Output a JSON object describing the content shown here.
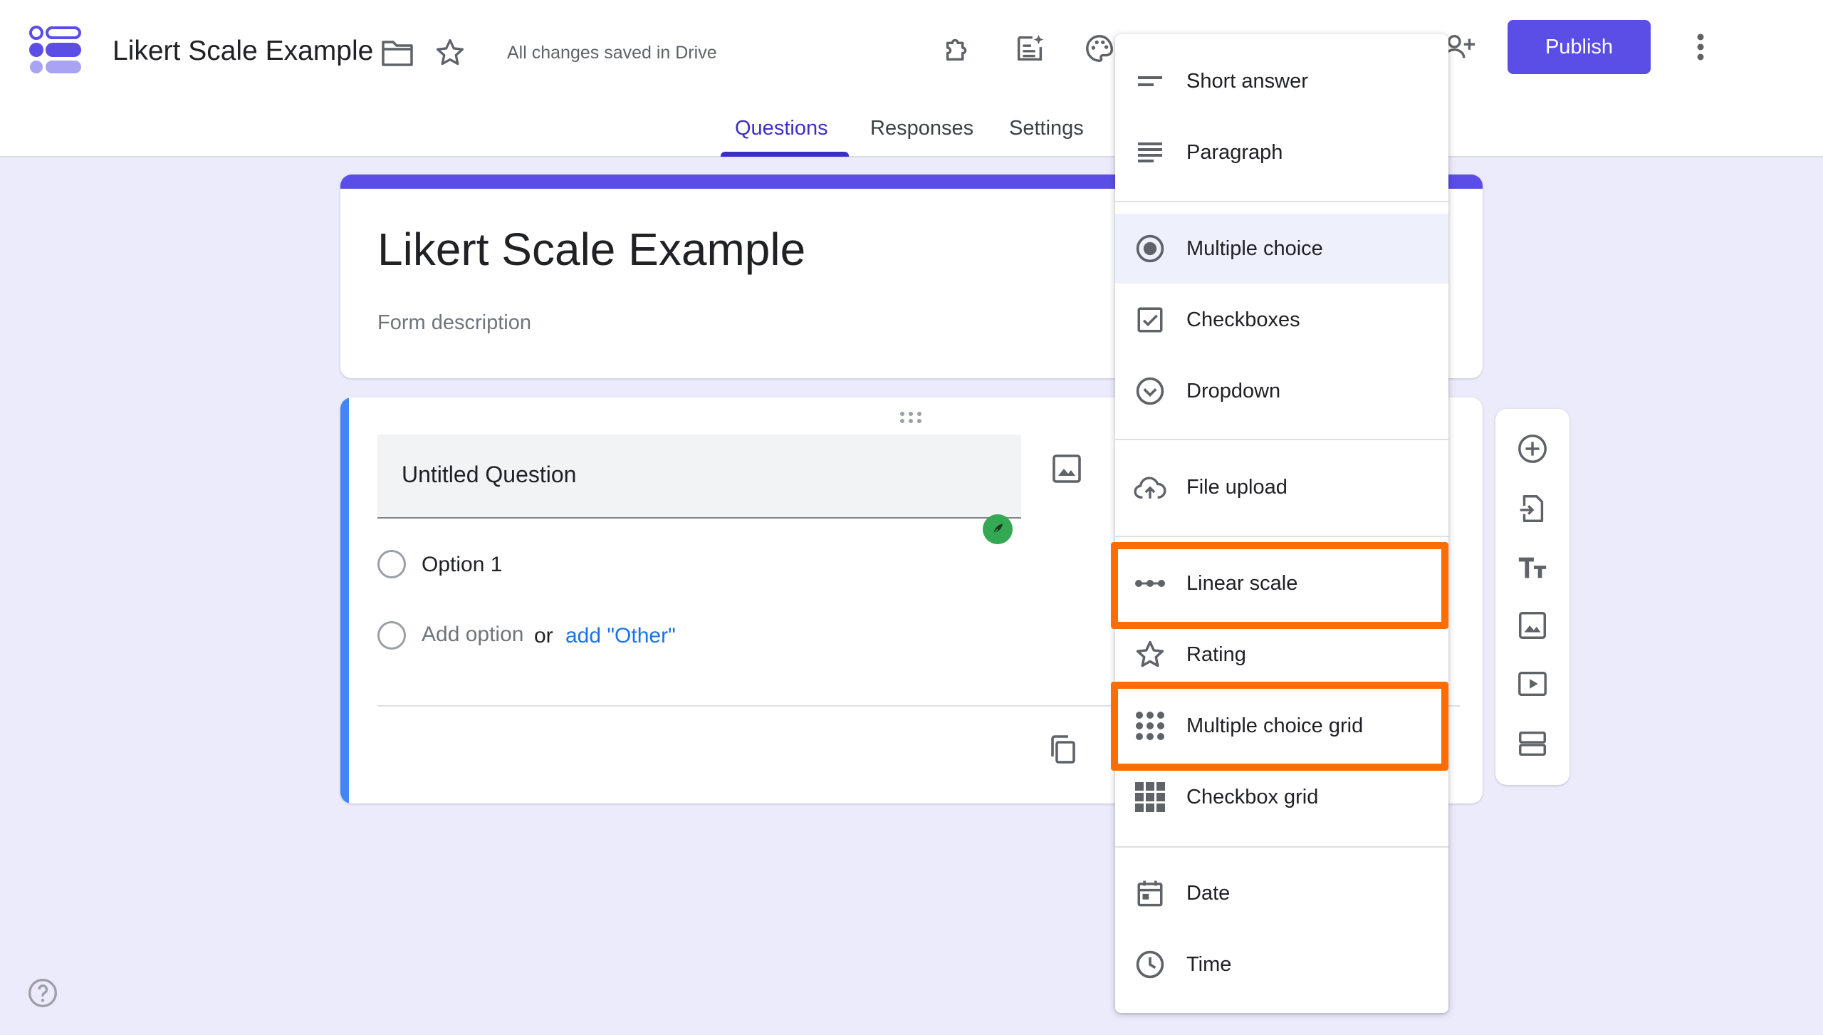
{
  "header": {
    "doc_title": "Likert Scale Example",
    "save_status": "All changes saved in Drive",
    "publish_label": "Publish",
    "icons": [
      "forms-logo",
      "folder-icon",
      "star-icon",
      "addon-puzzle-icon",
      "ai-sparkle-sheet-icon",
      "palette-icon",
      "add-person-icon",
      "more-vert-icon"
    ]
  },
  "tabs": [
    {
      "label": "Questions",
      "active": true
    },
    {
      "label": "Responses",
      "active": false
    },
    {
      "label": "Settings",
      "active": false
    }
  ],
  "form": {
    "title": "Likert Scale Example",
    "description_placeholder": "Form description"
  },
  "question": {
    "title": "Untitled Question",
    "options": [
      "Option 1"
    ],
    "add_option": "Add option",
    "or_text": "or",
    "add_other": "add \"Other\""
  },
  "question_type_menu": {
    "items": [
      {
        "label": "Short answer",
        "icon": "short-answer-icon"
      },
      {
        "label": "Paragraph",
        "icon": "paragraph-icon"
      },
      {
        "label": "Multiple choice",
        "icon": "radio-button-icon",
        "selected": true
      },
      {
        "label": "Checkboxes",
        "icon": "checkbox-icon"
      },
      {
        "label": "Dropdown",
        "icon": "dropdown-circle-icon"
      },
      {
        "label": "File upload",
        "icon": "cloud-upload-icon"
      },
      {
        "label": "Linear scale",
        "icon": "linear-scale-icon",
        "highlighted": true
      },
      {
        "label": "Rating",
        "icon": "star-outline-icon"
      },
      {
        "label": "Multiple choice grid",
        "icon": "dot-grid-icon",
        "highlighted": true
      },
      {
        "label": "Checkbox grid",
        "icon": "square-grid-icon"
      },
      {
        "label": "Date",
        "icon": "calendar-icon"
      },
      {
        "label": "Time",
        "icon": "clock-icon"
      }
    ],
    "highlight_color": "#ff6d00"
  },
  "side_toolbar": {
    "buttons": [
      "add-question-icon",
      "import-questions-icon",
      "add-title-icon",
      "add-image-icon",
      "add-video-icon",
      "add-section-icon"
    ]
  },
  "colors": {
    "accent": "#5b4ee6",
    "background": "#ecebfc",
    "question_accent": "#4285f4",
    "link": "#1a73e8"
  }
}
